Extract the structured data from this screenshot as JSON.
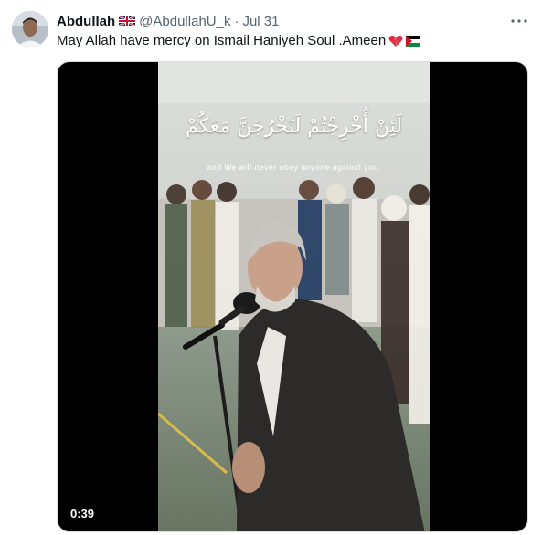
{
  "tweet": {
    "author_name": "Abdullah",
    "author_handle": "@AbdullahU_k",
    "separator": "·",
    "date": "Jul 31",
    "text": "May Allah have mercy on Ismail Haniyeh Soul .Ameen",
    "text_emojis": [
      "broken-heart-icon",
      "palestine-flag-icon"
    ],
    "author_badge": "uk-flag-icon",
    "more_icon": "more-dots-icon"
  },
  "video": {
    "caption_arabic": "لَئِنْ أُخْرِجْتُمْ لَنَخْرُجَنَّ مَعَكُمْ",
    "caption_english": "and We will never obey anyone against you.",
    "duration": "0:39"
  },
  "colors": {
    "text_primary": "#0f1419",
    "text_secondary": "#536471",
    "media_background": "#000000"
  }
}
